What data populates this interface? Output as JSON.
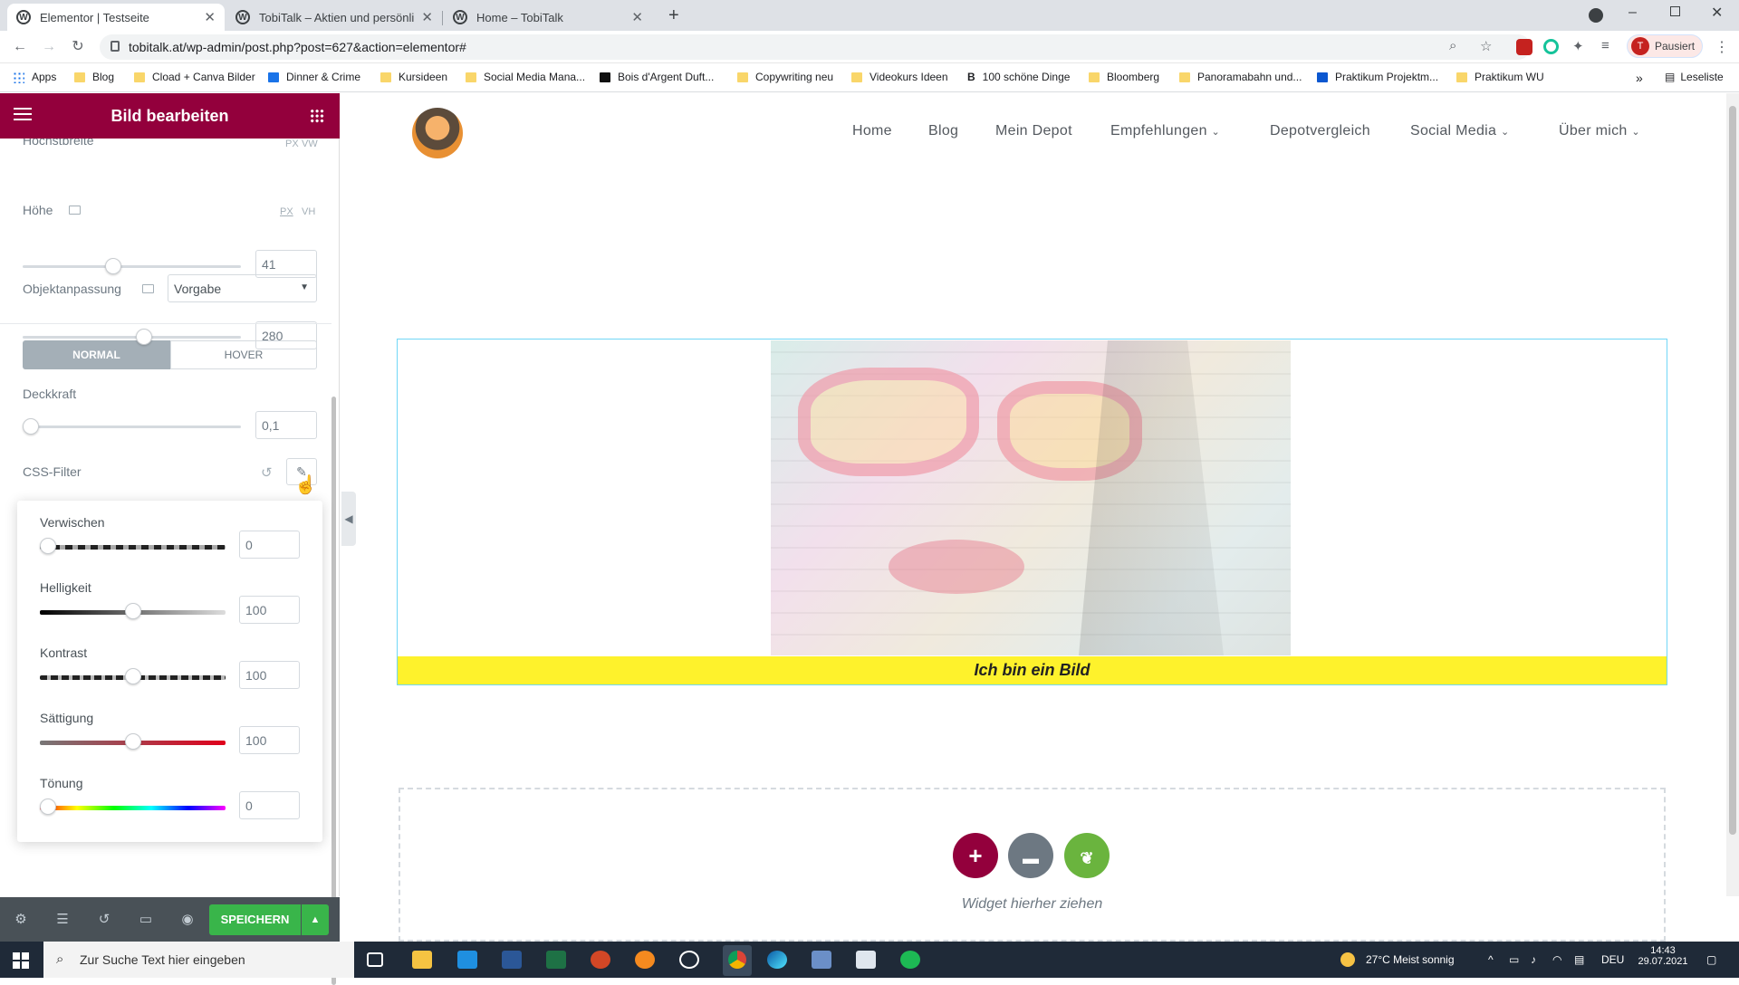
{
  "browser": {
    "tabs": [
      {
        "title": "Elementor | Testseite",
        "active": true
      },
      {
        "title": "TobiTalk – Aktien und persönlich",
        "active": false
      },
      {
        "title": "Home – TobiTalk",
        "active": false
      }
    ],
    "url": "tobitalk.at/wp-admin/post.php?post=627&action=elementor#",
    "profile_label": "Pausiert",
    "profile_initial": "T",
    "bookmarks": [
      "Apps",
      "Blog",
      "Cload + Canva Bilder",
      "Dinner & Crime",
      "Kursideen",
      "Social Media Mana...",
      "Bois d'Argent Duft...",
      "Copywriting neu",
      "Videokurs Ideen",
      "100 schöne Dinge",
      "Bloomberg",
      "Panoramabahn und...",
      "Praktikum Projektm...",
      "Praktikum WU"
    ],
    "reading_list": "Leseliste"
  },
  "panel": {
    "title": "Bild bearbeiten",
    "max_width": {
      "label": "Höchstbreite",
      "value": "41",
      "fraction": 0.41,
      "units": [
        "PX",
        "VW"
      ]
    },
    "height": {
      "label": "Höhe",
      "value": "280",
      "fraction": 0.56,
      "units": [
        "PX",
        "VH"
      ]
    },
    "object_fit": {
      "label": "Objektanpassung",
      "value": "Vorgabe"
    },
    "state_tabs": {
      "normal": "NORMAL",
      "hover": "HOVER"
    },
    "opacity": {
      "label": "Deckkraft",
      "value": "0,1",
      "fraction": 0.0
    },
    "css_filter": {
      "label": "CSS-Filter"
    },
    "filters": {
      "blur": {
        "label": "Verwischen",
        "value": "0",
        "fraction": 0.0
      },
      "brightness": {
        "label": "Helligkeit",
        "value": "100",
        "fraction": 0.5
      },
      "contrast": {
        "label": "Kontrast",
        "value": "100",
        "fraction": 0.5
      },
      "saturation": {
        "label": "Sättigung",
        "value": "100",
        "fraction": 0.5
      },
      "hue": {
        "label": "Tönung",
        "value": "0",
        "fraction": 0.0
      }
    },
    "save_label": "SPEICHERN"
  },
  "site": {
    "nav": [
      "Home",
      "Blog",
      "Mein Depot",
      "Empfehlungen",
      "Depotvergleich",
      "Social Media",
      "Über mich"
    ],
    "nav_dropdown": [
      false,
      false,
      false,
      true,
      false,
      true,
      true
    ],
    "caption": "Ich bin ein Bild",
    "drop_hint": "Widget hierher ziehen"
  },
  "taskbar": {
    "search_placeholder": "Zur Suche Text hier eingeben",
    "weather": "27°C  Meist sonnig",
    "lang": "DEU",
    "time": "14:43",
    "date": "29.07.2021"
  },
  "colors": {
    "accent": "#93003c",
    "save_green": "#39b54a",
    "caption_yellow": "#fef22c",
    "selection_blue": "#71d7f7"
  }
}
